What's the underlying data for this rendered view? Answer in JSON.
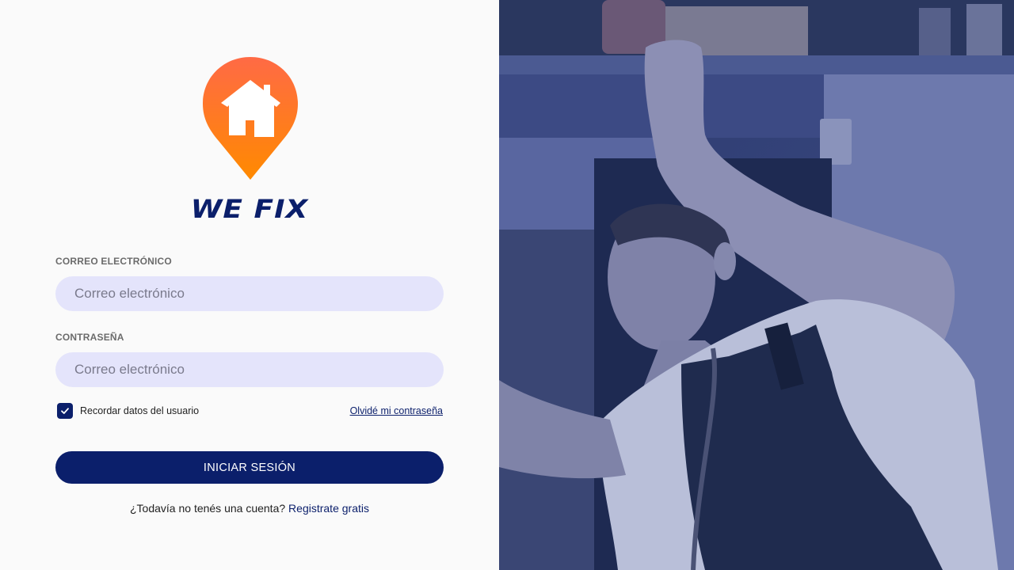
{
  "brand": {
    "name": "WE FIX"
  },
  "form": {
    "email_label": "CORREO ELECTRÓNICO",
    "email_placeholder": "Correo electrónico",
    "password_label": "CONTRASEÑA",
    "password_placeholder": "Correo electrónico",
    "remember_label": "Recordar datos del usuario",
    "remember_checked": true,
    "forgot_link": "Olvidé mi contraseña",
    "submit_label": "INICIAR SESIÓN",
    "signup_prompt": "¿Todavía no tenés una cuenta?",
    "signup_link": "Registrate gratis"
  },
  "colors": {
    "primary": "#0b1f6b",
    "input_bg": "#e4e4fb",
    "pin_top": "#ff6a45",
    "pin_bottom": "#ff8a00",
    "photo_overlay": "#2a3a86"
  }
}
